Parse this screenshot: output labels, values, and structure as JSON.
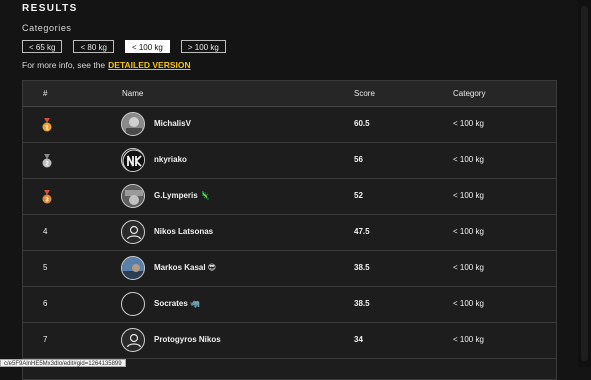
{
  "header": {
    "title": "RESULTS",
    "subtitle": "Categories"
  },
  "categories": [
    {
      "label": "< 65 kg",
      "active": false
    },
    {
      "label": "< 80 kg",
      "active": false
    },
    {
      "label": "< 100 kg",
      "active": true
    },
    {
      "label": "> 100 kg",
      "active": false
    }
  ],
  "info": {
    "text": "For more info, see the",
    "link": "DETAILED VERSION"
  },
  "table": {
    "columns": {
      "rank": "#",
      "name": "Name",
      "score": "Score",
      "category": "Category"
    },
    "rows": [
      {
        "rank": "1",
        "medal": "gold",
        "name": "MichalisV",
        "score": "60.5",
        "category": "< 100 kg",
        "avatar": "photo"
      },
      {
        "rank": "2",
        "medal": "silver",
        "name": "nkyriako",
        "score": "56",
        "category": "< 100 kg",
        "avatar": "logo"
      },
      {
        "rank": "3",
        "medal": "bronze",
        "name": "G.Lymperis 🦎",
        "score": "52",
        "category": "< 100 kg",
        "avatar": "photo"
      },
      {
        "rank": "4",
        "medal": "",
        "name": "Nikos Latsonas",
        "score": "47.5",
        "category": "< 100 kg",
        "avatar": "default"
      },
      {
        "rank": "5",
        "medal": "",
        "name": "Markos Kasal 😎",
        "score": "38.5",
        "category": "< 100 kg",
        "avatar": "photo-blue"
      },
      {
        "rank": "6",
        "medal": "",
        "name": "Socrates 🦏",
        "score": "38.5",
        "category": "< 100 kg",
        "avatar": "blank"
      },
      {
        "rank": "7",
        "medal": "",
        "name": "Protogyros Nikos",
        "score": "34",
        "category": "< 100 kg",
        "avatar": "default"
      }
    ]
  },
  "statusbar": {
    "url": "c/e5F9AlnHE5Mx3dlo/edit#gid=1264135899"
  },
  "colors": {
    "accent": "#f0c417",
    "gold": "#e8a33d",
    "silver": "#bdbdbd",
    "bronze": "#d98a3a"
  }
}
